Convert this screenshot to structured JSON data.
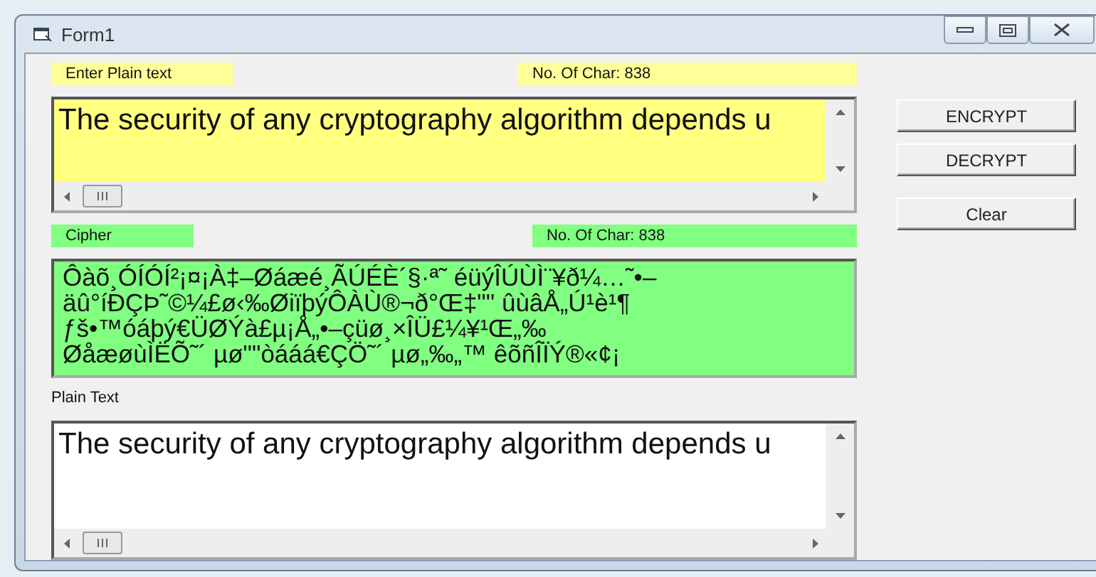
{
  "window": {
    "title": "Form1"
  },
  "plain_input": {
    "label": "Enter Plain text",
    "count": "No. Of Char: 838",
    "value": "The security of any cryptography algorithm depends u"
  },
  "buttons": [
    {
      "label": "ENCRYPT"
    },
    {
      "label": "DECRYPT"
    },
    {
      "label": "Clear"
    }
  ],
  "cipher": {
    "label": "Cipher",
    "count": "No. Of Char: 838",
    "lines": [
      "Ôàõ¸ÓÍÓÍ²¡¤¡À‡–Øáæé¸ÃÚÉÈ´§·ª˜ éüýÎÚÙÌ¨¥ð¼…˜•–",
      "äû°íÐÇÞ˜©¼£ø‹‰ØiïþýÔÀÙ®¬ð°Œ‡\"\" ûùâÅ„Ú¹è¹¶",
      "ƒš•™óáþý€ÜØÝà£µ¡Å„•–çüø¸×ÎÜ£¼¥¹Œ„‰",
      "ØåæøùÌËÕ˜´ µø\"\"òááá€ÇÖ˜´ µø„‰„™ êõñÎÏÝ®«¢¡"
    ]
  },
  "plain_output": {
    "label": "Plain Text",
    "value": "The security of any cryptography algorithm depends u"
  }
}
